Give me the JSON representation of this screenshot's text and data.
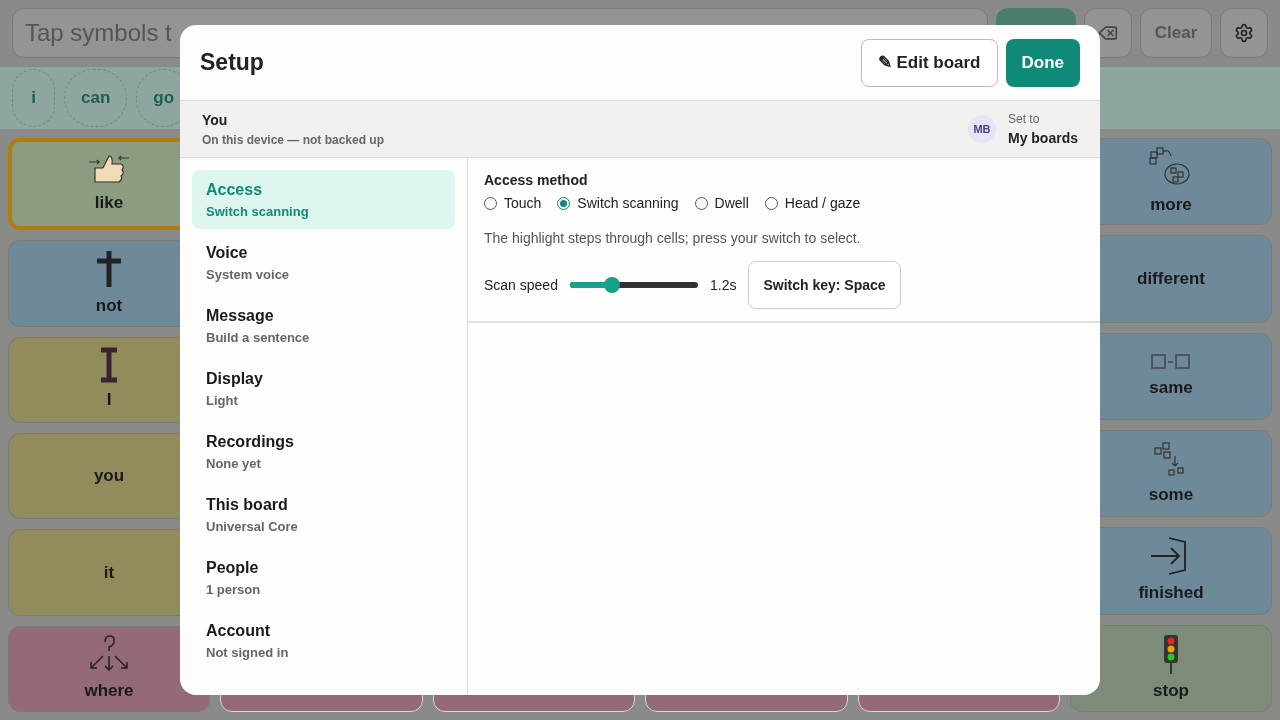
{
  "board": {
    "message_placeholder": "Tap symbols t",
    "clear_label": "Clear",
    "chips": [
      "i",
      "can",
      "go"
    ],
    "left_column": [
      {
        "label": "like",
        "color": "#8c9c80",
        "selected": true
      },
      {
        "label": "not",
        "color": "#6e8a9a",
        "selected": false
      },
      {
        "label": "I",
        "color": "#928c5c",
        "selected": false
      },
      {
        "label": "you",
        "color": "#928c5c",
        "selected": false
      },
      {
        "label": "it",
        "color": "#928c5c",
        "selected": false
      },
      {
        "label": "where",
        "color": "#946a78",
        "selected": false
      }
    ],
    "bottom_row": [
      {
        "color": "#946a78"
      },
      {
        "color": "#946a78"
      },
      {
        "color": "#946a78"
      },
      {
        "color": "#946a78"
      }
    ],
    "right_column": [
      {
        "label": "more",
        "color": "#6e8a9a",
        "selected": false
      },
      {
        "label": "different",
        "color": "#6e8a9a",
        "selected": false
      },
      {
        "label": "same",
        "color": "#6e8a9a",
        "selected": false
      },
      {
        "label": "some",
        "color": "#6e8a9a",
        "selected": false
      },
      {
        "label": "finished",
        "color": "#6e8a9a",
        "selected": false
      },
      {
        "label": "stop",
        "color": "#7c8c78",
        "selected": false
      }
    ]
  },
  "setup": {
    "title": "Setup",
    "edit_button": "✎ Edit board",
    "done_button": "Done",
    "profile": {
      "name": "You",
      "detail": "On this device — not backed up",
      "initials": "MB",
      "set_to_label": "Set to",
      "set_to_value": "My boards"
    },
    "sections": [
      {
        "title": "Access",
        "subtitle": "Switch scanning",
        "selected": true
      },
      {
        "title": "Voice",
        "subtitle": "System voice",
        "selected": false
      },
      {
        "title": "Message",
        "subtitle": "Build a sentence",
        "selected": false
      },
      {
        "title": "Display",
        "subtitle": "Light",
        "selected": false
      },
      {
        "title": "Recordings",
        "subtitle": "None yet",
        "selected": false
      },
      {
        "title": "This board",
        "subtitle": "Universal Core",
        "selected": false
      },
      {
        "title": "People",
        "subtitle": "1 person",
        "selected": false
      },
      {
        "title": "Account",
        "subtitle": "Not signed in",
        "selected": false
      }
    ],
    "access": {
      "heading": "Access method",
      "methods": [
        {
          "label": "Touch",
          "selected": false
        },
        {
          "label": "Switch scanning",
          "selected": true
        },
        {
          "label": "Dwell",
          "selected": false
        },
        {
          "label": "Head / gaze",
          "selected": false
        }
      ],
      "hint": "The highlight steps through cells; press your switch to select.",
      "speed_label": "Scan speed",
      "speed": {
        "level": 0.33
      },
      "speed_reading": "1.2s",
      "switch_key_button": "Switch key: Space"
    }
  }
}
